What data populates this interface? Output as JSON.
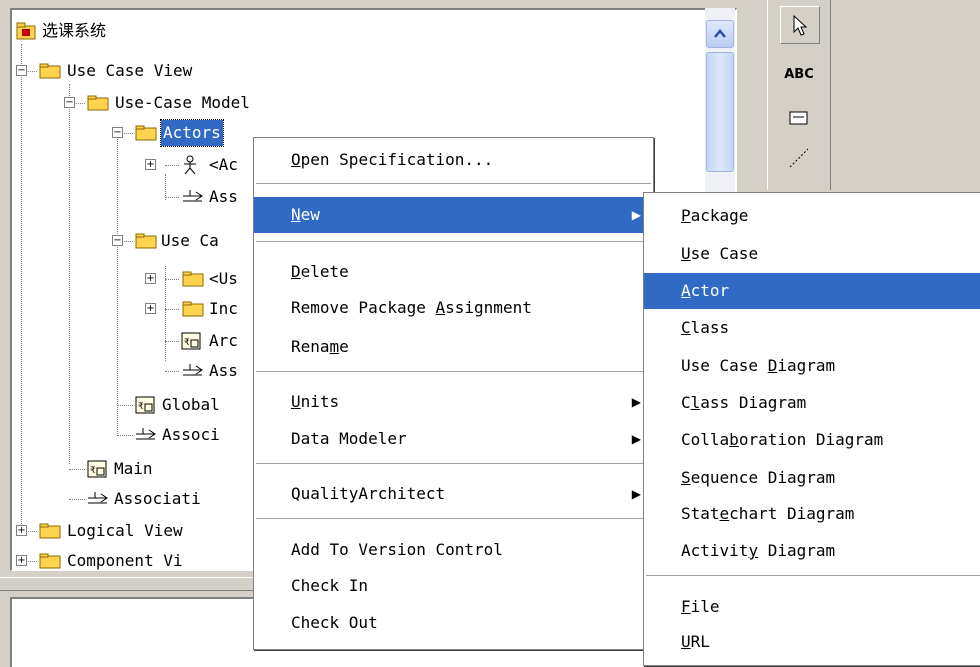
{
  "tree": {
    "root_label": "选课系统",
    "items": [
      {
        "label": "Use Case View",
        "expander": "−"
      },
      {
        "label": "Use-Case Model",
        "expander": "−"
      },
      {
        "label": "Actors",
        "expander": "−",
        "selected": true
      },
      {
        "label": "<Ac",
        "expander": "+"
      },
      {
        "label": "Ass"
      },
      {
        "label": "Use Ca",
        "expander": "−"
      },
      {
        "label": "<Us",
        "expander": "+"
      },
      {
        "label": "Inc",
        "expander": "+"
      },
      {
        "label": "Arc"
      },
      {
        "label": "Ass"
      },
      {
        "label": "Global"
      },
      {
        "label": "Associ"
      },
      {
        "label": "Main"
      },
      {
        "label": "Associati"
      },
      {
        "label": "Logical View",
        "expander": "+"
      },
      {
        "label": "Component Vi",
        "expander": "+"
      }
    ]
  },
  "toolbox": {
    "abc_label": "ABC"
  },
  "context_menu": {
    "open_spec": {
      "pre": "",
      "key": "O",
      "post": "pen Specification..."
    },
    "new": {
      "pre": "",
      "key": "N",
      "post": "ew"
    },
    "delete": {
      "pre": "",
      "key": "D",
      "post": "elete"
    },
    "remove_assignment": {
      "pre": "Remove Package ",
      "key": "A",
      "post": "ssignment"
    },
    "rename": {
      "pre": "Rena",
      "key": "m",
      "post": "e"
    },
    "units": {
      "pre": "",
      "key": "U",
      "post": "nits"
    },
    "data_modeler": {
      "pre": "Data Modeler",
      "key": "",
      "post": ""
    },
    "quality_architect": {
      "pre": "QualityArchitect",
      "key": "",
      "post": ""
    },
    "add_version": {
      "pre": "Add To Version Control",
      "key": "",
      "post": ""
    },
    "check_in": {
      "pre": "Check In",
      "key": "",
      "post": ""
    },
    "check_out": {
      "pre": "Check Out",
      "key": "",
      "post": ""
    }
  },
  "submenu": {
    "package": {
      "pre": "",
      "key": "P",
      "post": "ackage"
    },
    "use_case": {
      "pre": "",
      "key": "U",
      "post": "se Case"
    },
    "actor": {
      "pre": "",
      "key": "A",
      "post": "ctor"
    },
    "class": {
      "pre": "",
      "key": "C",
      "post": "lass"
    },
    "use_case_diagram": {
      "pre": "Use Case ",
      "key": "D",
      "post": "iagram"
    },
    "class_diagram": {
      "pre": "C",
      "key": "l",
      "post": "ass Diagram"
    },
    "collaboration_diagram": {
      "pre": "Colla",
      "key": "b",
      "post": "oration Diagram"
    },
    "sequence_diagram": {
      "pre": "",
      "key": "S",
      "post": "equence Diagram"
    },
    "statechart_diagram": {
      "pre": "Stat",
      "key": "e",
      "post": "chart Diagram"
    },
    "activity_diagram": {
      "pre": "Activit",
      "key": "y",
      "post": " Diagram"
    },
    "file": {
      "pre": "",
      "key": "F",
      "post": "ile"
    },
    "url": {
      "pre": "",
      "key": "U",
      "post": "RL"
    }
  },
  "colors": {
    "highlight": "#316ac5",
    "folder": "#ffd34e"
  }
}
